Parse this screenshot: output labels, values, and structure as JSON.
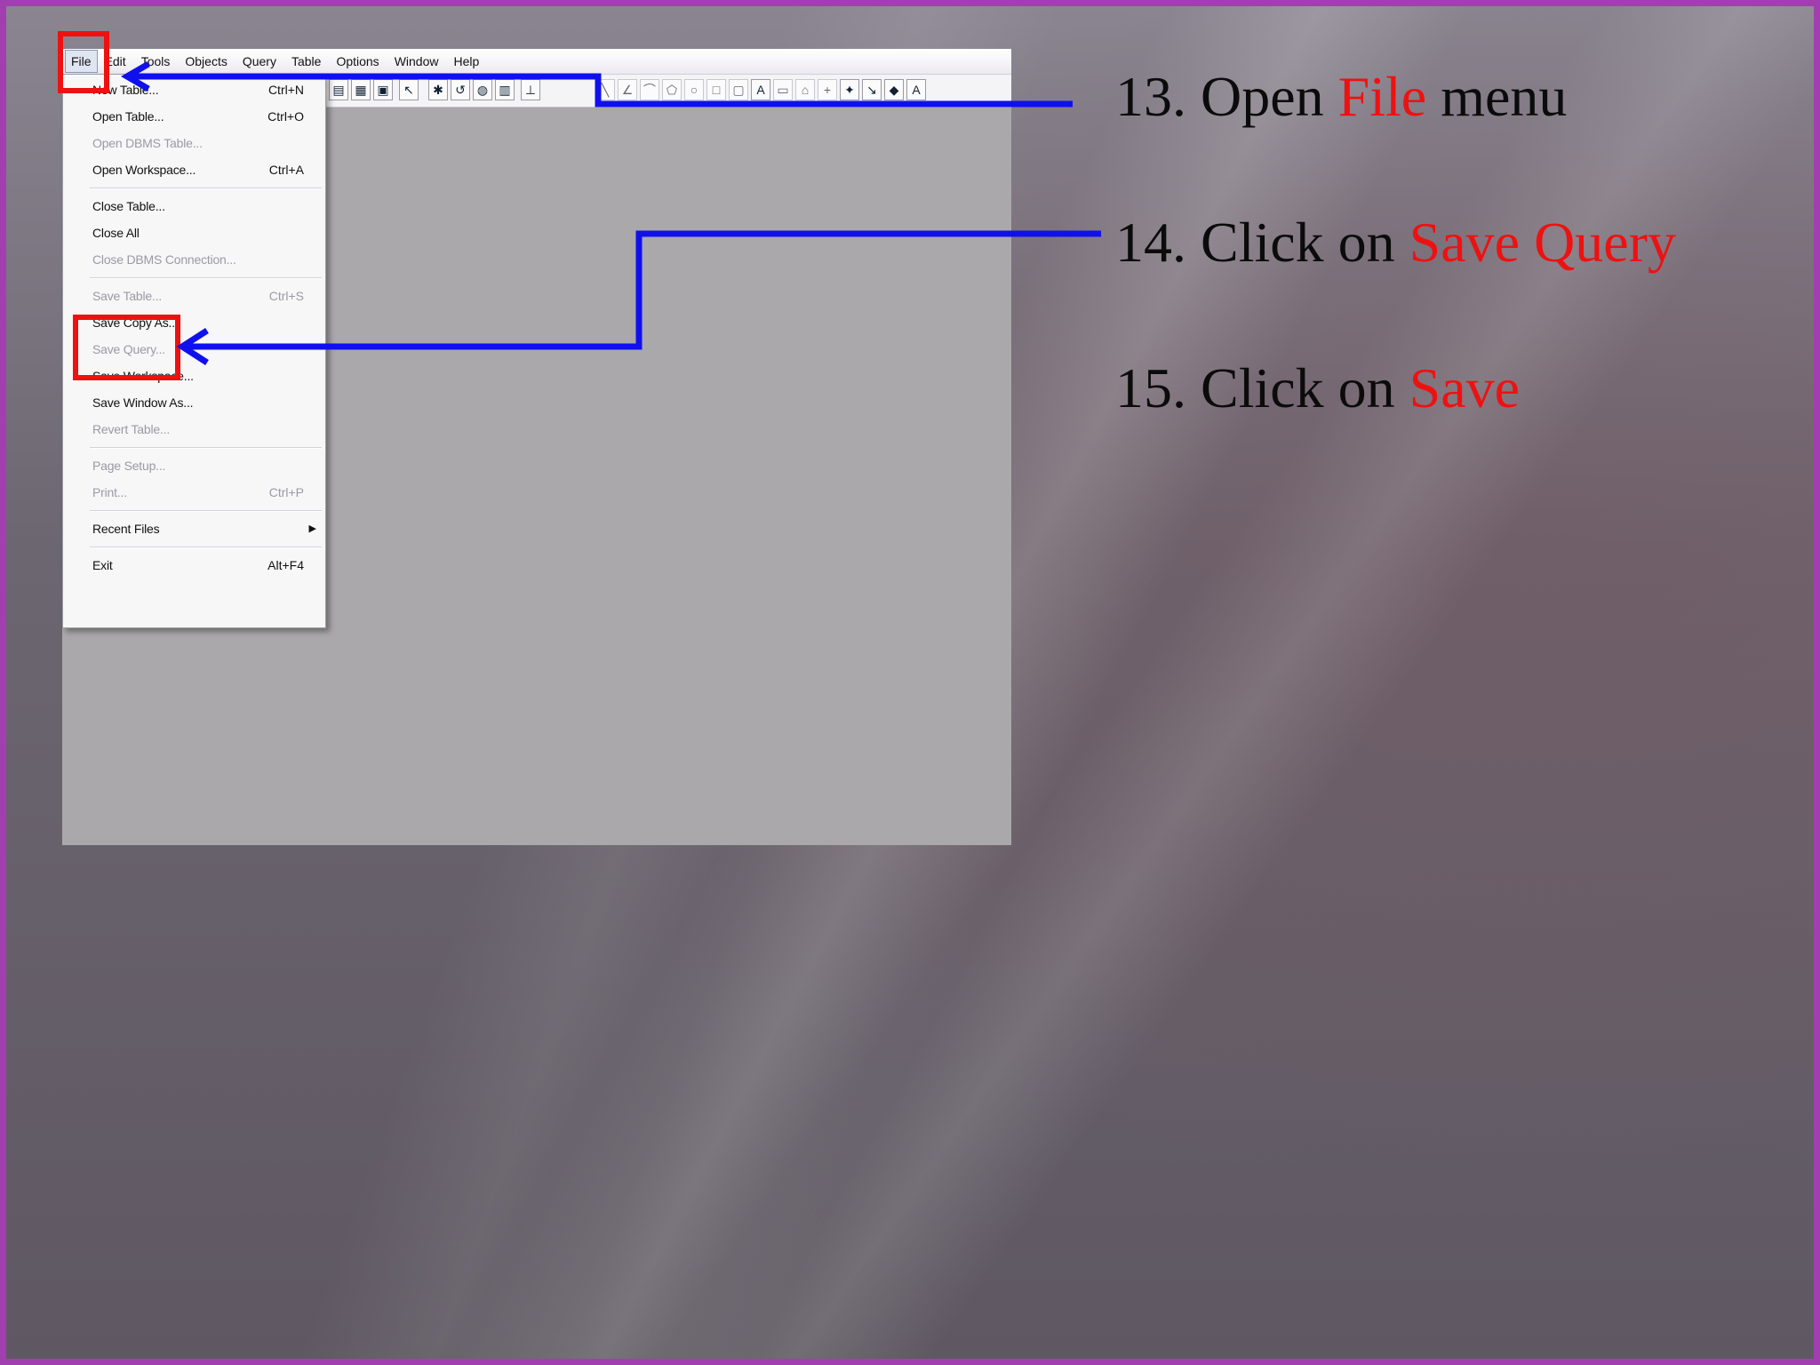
{
  "menubar": {
    "items": [
      "File",
      "Edit",
      "Tools",
      "Objects",
      "Query",
      "Table",
      "Options",
      "Window",
      "Help"
    ]
  },
  "file_menu": {
    "items": [
      {
        "label": "New Table...",
        "shortcut": "Ctrl+N",
        "enabled": true
      },
      {
        "label": "Open Table...",
        "shortcut": "Ctrl+O",
        "enabled": true
      },
      {
        "label": "Open DBMS Table...",
        "shortcut": "",
        "enabled": false
      },
      {
        "label": "Open Workspace...",
        "shortcut": "Ctrl+A",
        "enabled": true
      },
      {
        "label": "Close Table...",
        "shortcut": "",
        "enabled": true
      },
      {
        "label": "Close All",
        "shortcut": "",
        "enabled": true
      },
      {
        "label": "Close DBMS Connection...",
        "shortcut": "",
        "enabled": false
      },
      {
        "label": "Save Table...",
        "shortcut": "Ctrl+S",
        "enabled": false
      },
      {
        "label": "Save Copy As...",
        "shortcut": "",
        "enabled": true
      },
      {
        "label": "Save Query...",
        "shortcut": "",
        "enabled": false
      },
      {
        "label": "Save Workspace...",
        "shortcut": "",
        "enabled": true
      },
      {
        "label": "Save Window As...",
        "shortcut": "",
        "enabled": true
      },
      {
        "label": "Revert Table...",
        "shortcut": "",
        "enabled": false
      },
      {
        "label": "Page Setup...",
        "shortcut": "",
        "enabled": false
      },
      {
        "label": "Print...",
        "shortcut": "Ctrl+P",
        "enabled": false
      },
      {
        "label": "Recent Files",
        "shortcut": "",
        "enabled": true,
        "submenu": true
      },
      {
        "label": "Exit",
        "shortcut": "Alt+F4",
        "enabled": true
      }
    ]
  },
  "instructions": [
    {
      "prefix": "13. Open ",
      "highlight": "File",
      "suffix": " menu"
    },
    {
      "prefix": "14. Click on ",
      "highlight": "Save Query",
      "suffix": ""
    },
    {
      "prefix": "15. Click on ",
      "highlight": "Save",
      "suffix": ""
    }
  ],
  "colors": {
    "highlight_red": "#ee1111",
    "arrow_blue": "#1010ee",
    "slide_border": "#a23fb0"
  }
}
